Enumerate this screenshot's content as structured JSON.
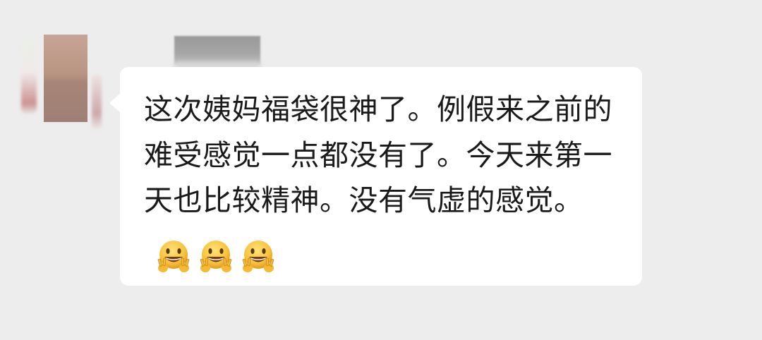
{
  "chat": {
    "message": {
      "text": "这次姨妈福袋很神了。例假来之前的难受感觉一点都没有了。今天来第一天也比较精神。没有气虚的感觉。",
      "emojis": [
        "grin-peace-emoji",
        "grin-peace-emoji",
        "grin-peace-emoji"
      ]
    }
  },
  "colors": {
    "background": "#ededed",
    "bubble": "#ffffff",
    "text": "#1a1a1a",
    "emoji_face": "#f7c23b"
  }
}
